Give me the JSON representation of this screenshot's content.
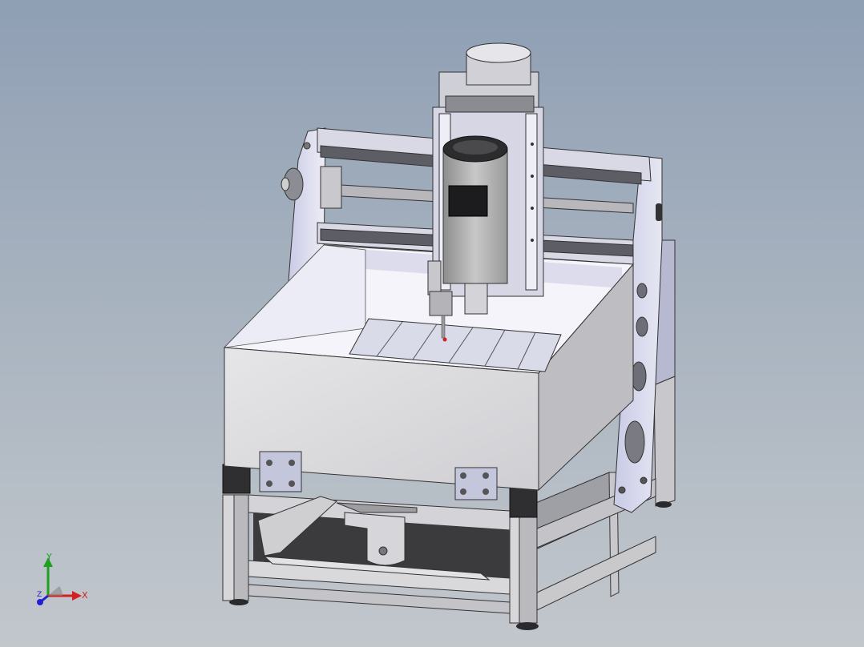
{
  "viewport": {
    "background_top": "#8f9fb4",
    "background_bottom": "#c2c7cc"
  },
  "model": {
    "parts": [
      "base-frame",
      "work-box",
      "t-slot-table",
      "gantry-left-plate",
      "gantry-right-plate",
      "linear-rail-top",
      "linear-rail-bottom",
      "lead-screw",
      "z-axis-carriage",
      "stepper-motor",
      "spindle-motor",
      "collet",
      "cutting-tool",
      "hinge-left",
      "hinge-right",
      "adjustable-feet"
    ]
  },
  "triad": {
    "x_label": "X",
    "y_label": "Y",
    "z_label": "Z",
    "x_color": "#d42020",
    "y_color": "#20a020",
    "z_color": "#2020d0"
  }
}
